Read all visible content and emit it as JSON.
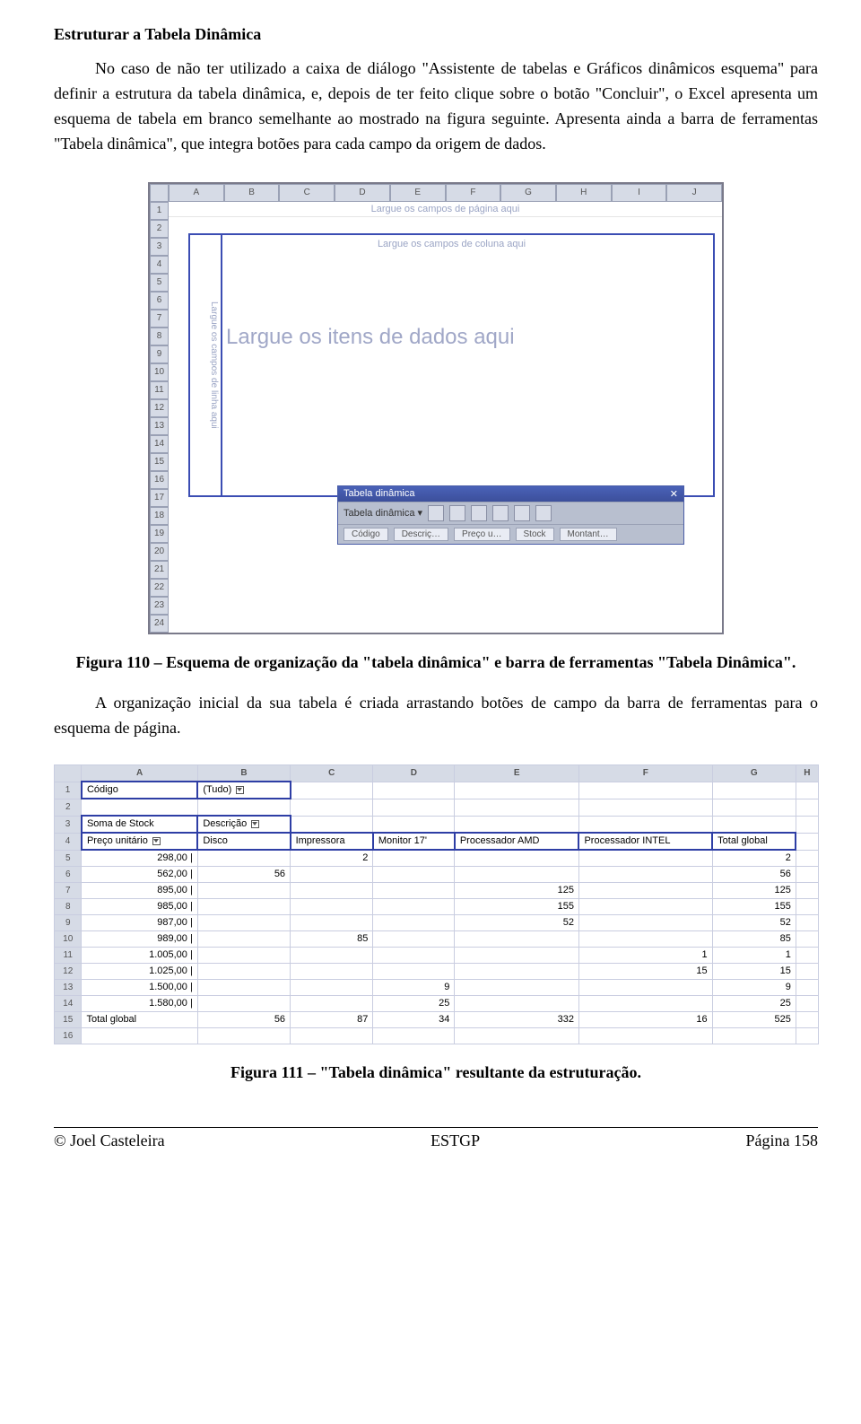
{
  "heading": "Estruturar a Tabela Dinâmica",
  "para1": "No caso de não ter utilizado a caixa de diálogo \"Assistente de tabelas e Gráficos dinâmicos esquema\" para definir a estrutura da tabela dinâmica, e, depois de ter feito clique sobre o botão \"Concluir\", o Excel apresenta um esquema de tabela em branco semelhante ao mostrado na figura seguinte. Apresenta ainda a barra de ferramentas \"Tabela dinâmica\", que integra botões para cada campo da origem de dados.",
  "shot1": {
    "cols": [
      "A",
      "B",
      "C",
      "D",
      "E",
      "F",
      "G",
      "H",
      "I",
      "J"
    ],
    "rows": [
      "1",
      "2",
      "3",
      "4",
      "5",
      "6",
      "7",
      "8",
      "9",
      "10",
      "11",
      "12",
      "13",
      "14",
      "15",
      "16",
      "17",
      "18",
      "19",
      "20",
      "21",
      "22",
      "23",
      "24"
    ],
    "page_field": "Largue os campos de página aqui",
    "col_field": "Largue os campos de coluna aqui",
    "row_field": "Largue os campos de linha aqui",
    "data_field": "Largue os itens de dados aqui",
    "toolbar_title": "Tabela dinâmica",
    "toolbar_menu": "Tabela dinâmica ▾",
    "fields": [
      "Código",
      "Descriç…",
      "Preço u…",
      "Stock",
      "Montant…"
    ]
  },
  "caption1": "Figura 110 – Esquema de organização da \"tabela dinâmica\" e barra de ferramentas \"Tabela Dinâmica\".",
  "para2": "A organização inicial da sua tabela é criada arrastando botões de campo da barra de ferramentas para o esquema de página.",
  "shot2": {
    "hdr": [
      "",
      "A",
      "B",
      "C",
      "D",
      "E",
      "F",
      "G",
      "H"
    ],
    "rows": [
      [
        "1",
        "Código",
        "(Tudo)",
        "",
        "",
        "",
        "",
        "",
        ""
      ],
      [
        "2",
        "",
        "",
        "",
        "",
        "",
        "",
        "",
        ""
      ],
      [
        "3",
        "Soma de Stock",
        "Descrição",
        "",
        "",
        "",
        "",
        "",
        ""
      ],
      [
        "4",
        "Preço unitário",
        "Disco",
        "Impressora",
        "Monitor 17'",
        "Processador AMD",
        "Processador INTEL",
        "Total global",
        ""
      ],
      [
        "5",
        "298,00 |",
        "",
        "2",
        "",
        "",
        "",
        "2",
        ""
      ],
      [
        "6",
        "562,00 |",
        "56",
        "",
        "",
        "",
        "",
        "56",
        ""
      ],
      [
        "7",
        "895,00 |",
        "",
        "",
        "",
        "125",
        "",
        "125",
        ""
      ],
      [
        "8",
        "985,00 |",
        "",
        "",
        "",
        "155",
        "",
        "155",
        ""
      ],
      [
        "9",
        "987,00 |",
        "",
        "",
        "",
        "52",
        "",
        "52",
        ""
      ],
      [
        "10",
        "989,00 |",
        "",
        "85",
        "",
        "",
        "",
        "85",
        ""
      ],
      [
        "11",
        "1.005,00 |",
        "",
        "",
        "",
        "",
        "1",
        "1",
        ""
      ],
      [
        "12",
        "1.025,00 |",
        "",
        "",
        "",
        "",
        "15",
        "15",
        ""
      ],
      [
        "13",
        "1.500,00 |",
        "",
        "",
        "9",
        "",
        "",
        "9",
        ""
      ],
      [
        "14",
        "1.580,00 |",
        "",
        "",
        "25",
        "",
        "",
        "25",
        ""
      ],
      [
        "15",
        "Total global",
        "56",
        "87",
        "34",
        "332",
        "16",
        "525",
        ""
      ],
      [
        "16",
        "",
        "",
        "",
        "",
        "",
        "",
        "",
        ""
      ]
    ]
  },
  "caption2": "Figura 111 – \"Tabela dinâmica\" resultante da estruturação.",
  "footer": {
    "left": "© Joel Casteleira",
    "center": "ESTGP",
    "right": "Página 158"
  }
}
